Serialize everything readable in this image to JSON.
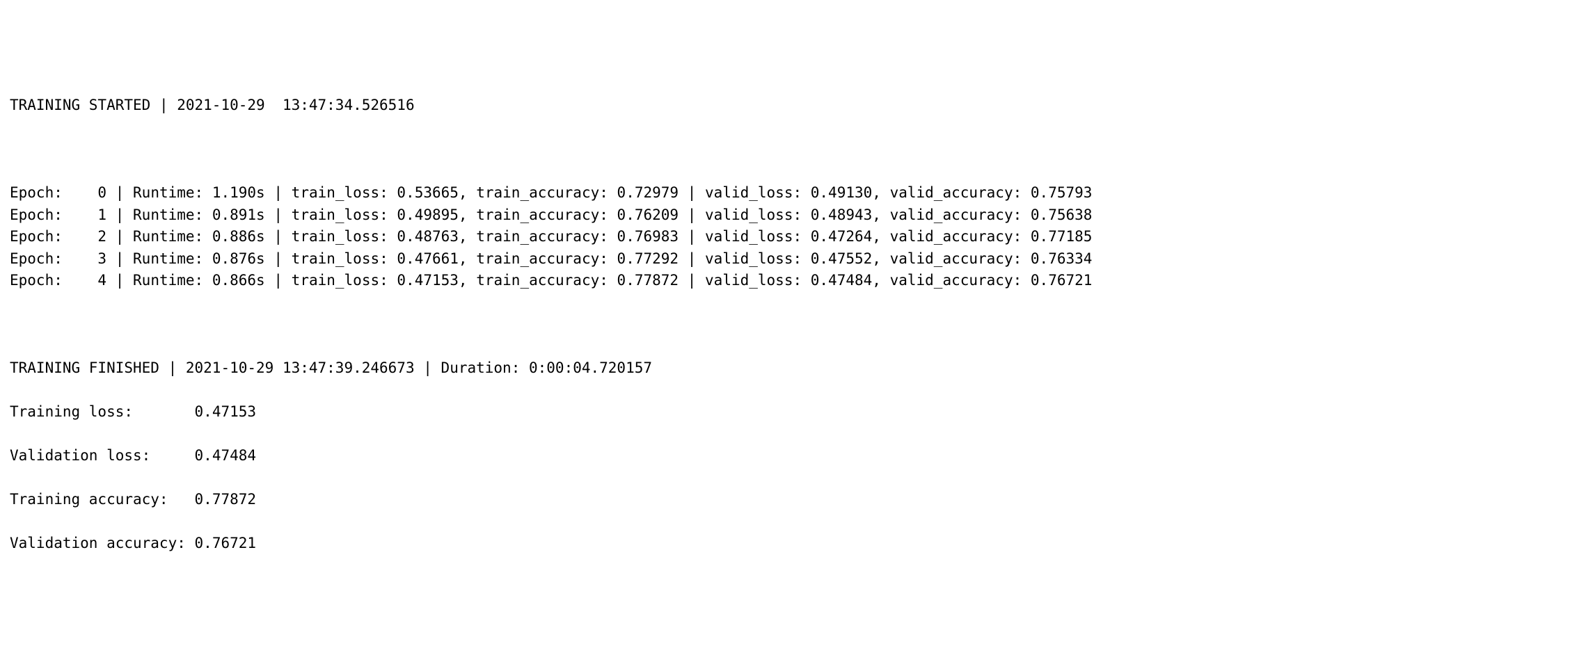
{
  "header": {
    "label": "TRAINING STARTED",
    "sep": " | ",
    "timestamp": "2021-10-29  13:47:34.526516"
  },
  "epochs": [
    {
      "idx": "0",
      "runtime": "1.190s",
      "train_loss": "0.53665",
      "train_accuracy": "0.72979",
      "valid_loss": "0.49130",
      "valid_accuracy": "0.75793"
    },
    {
      "idx": "1",
      "runtime": "0.891s",
      "train_loss": "0.49895",
      "train_accuracy": "0.76209",
      "valid_loss": "0.48943",
      "valid_accuracy": "0.75638"
    },
    {
      "idx": "2",
      "runtime": "0.886s",
      "train_loss": "0.48763",
      "train_accuracy": "0.76983",
      "valid_loss": "0.47264",
      "valid_accuracy": "0.77185"
    },
    {
      "idx": "3",
      "runtime": "0.876s",
      "train_loss": "0.47661",
      "train_accuracy": "0.77292",
      "valid_loss": "0.47552",
      "valid_accuracy": "0.76334"
    },
    {
      "idx": "4",
      "runtime": "0.866s",
      "train_loss": "0.47153",
      "train_accuracy": "0.77872",
      "valid_loss": "0.47484",
      "valid_accuracy": "0.76721"
    }
  ],
  "labels": {
    "epoch_prefix": "Epoch:",
    "runtime_prefix": "Runtime:",
    "train_loss": "train_loss:",
    "train_accuracy": "train_accuracy:",
    "valid_loss": "valid_loss:",
    "valid_accuracy": "valid_accuracy:",
    "pipe": "|",
    "comma": ","
  },
  "footer": {
    "label": "TRAINING FINISHED",
    "sep": " | ",
    "timestamp": "2021-10-29 13:47:39.246673",
    "duration_label": "Duration:",
    "duration": "0:00:04.720157"
  },
  "summary": {
    "training_loss_label": "Training loss:      ",
    "training_loss": "0.47153",
    "validation_loss_label": "Validation loss:    ",
    "validation_loss": "0.47484",
    "training_acc_label": "Training accuracy:  ",
    "training_acc": "0.77872",
    "validation_acc_label": "Validation accuracy:",
    "validation_acc": "0.76721"
  },
  "chart_data": {
    "type": "table",
    "title": "Training log",
    "columns": [
      "epoch",
      "runtime_s",
      "train_loss",
      "train_accuracy",
      "valid_loss",
      "valid_accuracy"
    ],
    "rows": [
      [
        0,
        1.19,
        0.53665,
        0.72979,
        0.4913,
        0.75793
      ],
      [
        1,
        0.891,
        0.49895,
        0.76209,
        0.48943,
        0.75638
      ],
      [
        2,
        0.886,
        0.48763,
        0.76983,
        0.47264,
        0.77185
      ],
      [
        3,
        0.876,
        0.47661,
        0.77292,
        0.47552,
        0.76334
      ],
      [
        4,
        0.866,
        0.47153,
        0.77872,
        0.47484,
        0.76721
      ]
    ]
  }
}
